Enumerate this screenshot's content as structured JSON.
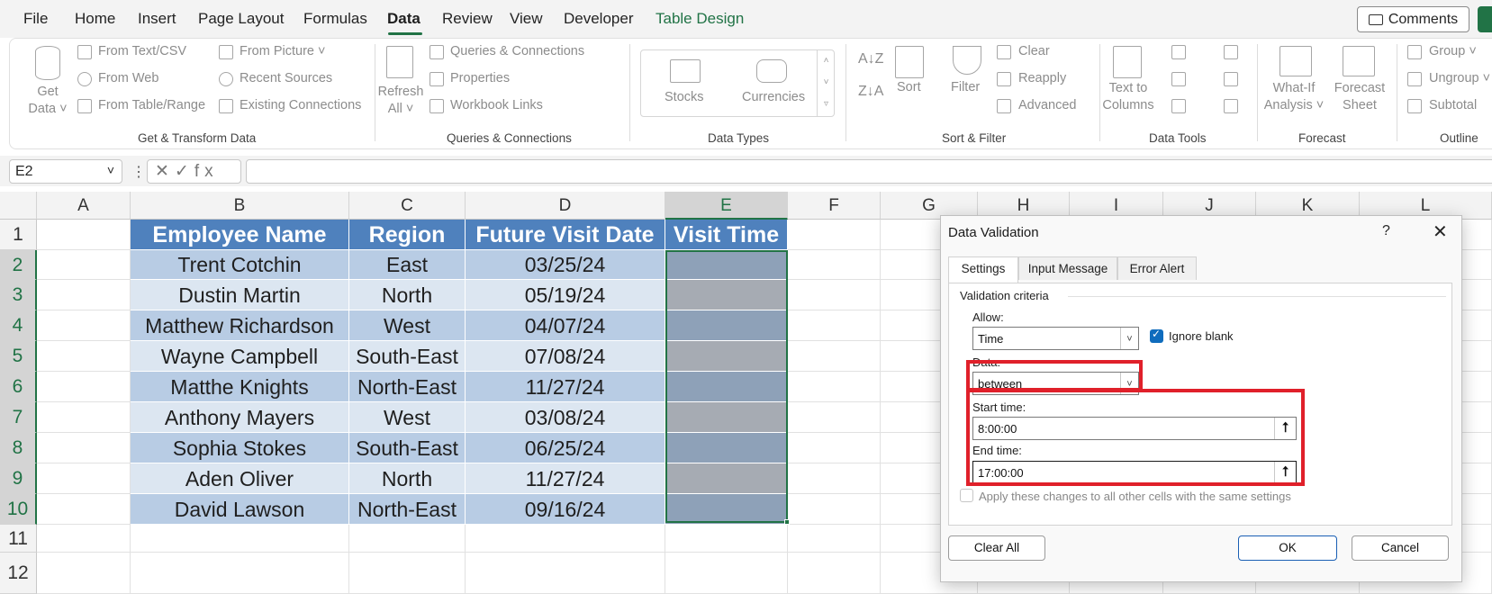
{
  "menu": {
    "items": [
      "File",
      "Home",
      "Insert",
      "Page Layout",
      "Formulas",
      "Data",
      "Review",
      "View",
      "Developer",
      "Table Design"
    ],
    "active": "Data",
    "comments_label": "Comments"
  },
  "ribbon": {
    "get_data": {
      "line1": "Get",
      "line2": "Data"
    },
    "from_text": "From Text/CSV",
    "from_web": "From Web",
    "from_table": "From Table/Range",
    "from_picture": "From Picture",
    "recent_sources": "Recent Sources",
    "existing_connections": "Existing Connections",
    "group_get_transform": "Get & Transform Data",
    "refresh": {
      "line1": "Refresh",
      "line2": "All"
    },
    "queries_connections": "Queries & Connections",
    "properties": "Properties",
    "workbook_links": "Workbook Links",
    "group_queries": "Queries & Connections",
    "stocks": "Stocks",
    "currencies": "Currencies",
    "group_data_types": "Data Types",
    "sort": "Sort",
    "filter": "Filter",
    "clear": "Clear",
    "reapply": "Reapply",
    "advanced": "Advanced",
    "group_sort_filter": "Sort & Filter",
    "text_to_columns": {
      "line1": "Text to",
      "line2": "Columns"
    },
    "group_data_tools": "Data Tools",
    "what_if": {
      "line1": "What-If",
      "line2": "Analysis"
    },
    "forecast_sheet": {
      "line1": "Forecast",
      "line2": "Sheet"
    },
    "group_forecast": "Forecast",
    "group_btn": "Group",
    "ungroup_btn": "Ungroup",
    "subtotal_btn": "Subtotal",
    "group_outline": "Outline"
  },
  "formula_bar": {
    "name_box": "E2",
    "fx_symbols": "✕✓fx",
    "formula": ""
  },
  "sheet": {
    "columns": [
      "A",
      "B",
      "C",
      "D",
      "E",
      "F",
      "G",
      "H",
      "I",
      "J",
      "K",
      "L"
    ],
    "rows": [
      "1",
      "2",
      "3",
      "4",
      "5",
      "6",
      "7",
      "8",
      "9",
      "10",
      "11",
      "12"
    ],
    "headers": [
      "Employee Name",
      "Region",
      "Future Visit Date",
      "Visit Time"
    ],
    "data": [
      [
        "Trent Cotchin",
        "East",
        "03/25/24",
        ""
      ],
      [
        "Dustin Martin",
        "North",
        "05/19/24",
        ""
      ],
      [
        "Matthew Richardson",
        "West",
        "04/07/24",
        ""
      ],
      [
        "Wayne Campbell",
        "South-East",
        "07/08/24",
        ""
      ],
      [
        "Matthe Knights",
        "North-East",
        "11/27/24",
        ""
      ],
      [
        "Anthony Mayers",
        "West",
        "03/08/24",
        ""
      ],
      [
        "Sophia Stokes",
        "South-East",
        "06/25/24",
        ""
      ],
      [
        "Aden Oliver",
        "North",
        "11/27/24",
        ""
      ],
      [
        "David Lawson",
        "North-East",
        "09/16/24",
        ""
      ]
    ],
    "colors": {
      "header": "#4f81bd",
      "band_a": "#b8cce4",
      "band_b": "#dce6f1",
      "accent": "#217346"
    }
  },
  "dialog": {
    "title": "Data Validation",
    "help": "?",
    "close": "✕",
    "tabs": [
      "Settings",
      "Input Message",
      "Error Alert"
    ],
    "section": "Validation criteria",
    "allow_label": "Allow:",
    "allow_value": "Time",
    "ignore_blank": "Ignore blank",
    "data_label": "Data:",
    "data_value": "between",
    "start_label": "Start time:",
    "start_value": "8:00:00",
    "end_label": "End time:",
    "end_value": "17:00:00",
    "apply_all": "Apply these changes to all other cells with the same settings",
    "clear_all": "Clear All",
    "ok": "OK",
    "cancel": "Cancel",
    "highlight_color": "#e0202a"
  }
}
